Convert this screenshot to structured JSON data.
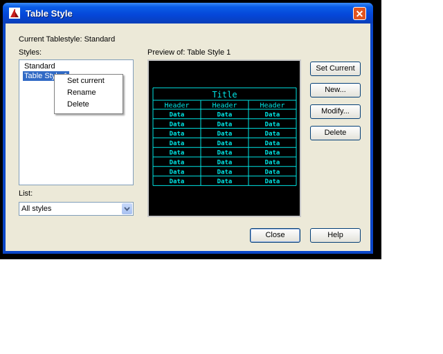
{
  "window": {
    "title": "Table Style"
  },
  "current_tablestyle": "Current Tablestyle: Standard",
  "styles": {
    "label": "Styles:",
    "items": [
      "Standard",
      "Table Style 1"
    ]
  },
  "list": {
    "label": "List:",
    "selected": "All styles"
  },
  "preview": {
    "label": "Preview of: Table Style 1",
    "table": {
      "title": "Title",
      "headers": [
        "Header",
        "Header",
        "Header"
      ],
      "cell": "Data"
    }
  },
  "buttons": {
    "set_current": "Set Current",
    "new": "New...",
    "modify": "Modify...",
    "delete": "Delete",
    "close": "Close",
    "help": "Help"
  },
  "context_menu": [
    "Set current",
    "Rename",
    "Delete"
  ],
  "colors": {
    "preview_line": "#00e5e5",
    "selection": "#316ac5",
    "titlebar": "#0a5ce6"
  }
}
